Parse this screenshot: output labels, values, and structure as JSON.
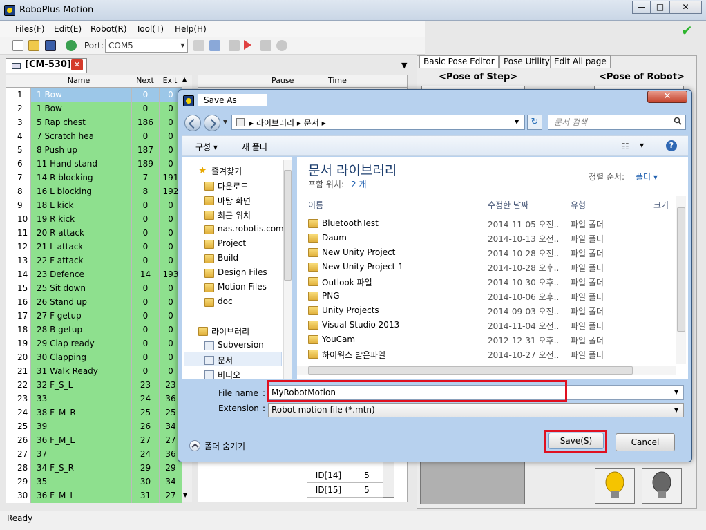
{
  "app": {
    "title": "RoboPlus Motion",
    "min_glyph": "—",
    "max_glyph": "□",
    "close_glyph": "✕"
  },
  "menu": [
    "Files(F)",
    "Edit(E)",
    "Robot(R)",
    "Tool(T)",
    "Help(H)"
  ],
  "toolbar": {
    "port_label": "Port:",
    "port_value": "COM5"
  },
  "cm_tab": {
    "label": "[CM-530]"
  },
  "grid": {
    "headers": [
      "Name",
      "Next",
      "Exit"
    ],
    "rows": [
      {
        "num": "1",
        "name": "1 Bow",
        "next": "0",
        "exit": "0"
      },
      {
        "num": "2",
        "name": "1 Bow",
        "next": "0",
        "exit": "0"
      },
      {
        "num": "3",
        "name": "5 Rap chest",
        "next": "186",
        "exit": "0"
      },
      {
        "num": "4",
        "name": "7 Scratch hea",
        "next": "0",
        "exit": "0"
      },
      {
        "num": "5",
        "name": "8 Push up",
        "next": "187",
        "exit": "0"
      },
      {
        "num": "6",
        "name": "11 Hand stand",
        "next": "189",
        "exit": "0"
      },
      {
        "num": "7",
        "name": "14 R blocking",
        "next": "7",
        "exit": "191"
      },
      {
        "num": "8",
        "name": "16 L blocking",
        "next": "8",
        "exit": "192"
      },
      {
        "num": "9",
        "name": "18 L kick",
        "next": "0",
        "exit": "0"
      },
      {
        "num": "10",
        "name": "19 R kick",
        "next": "0",
        "exit": "0"
      },
      {
        "num": "11",
        "name": "20 R attack",
        "next": "0",
        "exit": "0"
      },
      {
        "num": "12",
        "name": "21 L attack",
        "next": "0",
        "exit": "0"
      },
      {
        "num": "13",
        "name": "22 F attack",
        "next": "0",
        "exit": "0"
      },
      {
        "num": "14",
        "name": "23 Defence",
        "next": "14",
        "exit": "193"
      },
      {
        "num": "15",
        "name": "25 Sit down",
        "next": "0",
        "exit": "0"
      },
      {
        "num": "16",
        "name": "26 Stand up",
        "next": "0",
        "exit": "0"
      },
      {
        "num": "17",
        "name": "27 F getup",
        "next": "0",
        "exit": "0"
      },
      {
        "num": "18",
        "name": "28 B getup",
        "next": "0",
        "exit": "0"
      },
      {
        "num": "19",
        "name": "29 Clap ready",
        "next": "0",
        "exit": "0"
      },
      {
        "num": "20",
        "name": "30 Clapping",
        "next": "0",
        "exit": "0"
      },
      {
        "num": "21",
        "name": "31 Walk Ready",
        "next": "0",
        "exit": "0"
      },
      {
        "num": "22",
        "name": "32 F_S_L",
        "next": "23",
        "exit": "23"
      },
      {
        "num": "23",
        "name": "33",
        "next": "24",
        "exit": "36"
      },
      {
        "num": "24",
        "name": "38 F_M_R",
        "next": "25",
        "exit": "25"
      },
      {
        "num": "25",
        "name": "39",
        "next": "26",
        "exit": "34"
      },
      {
        "num": "26",
        "name": "36 F_M_L",
        "next": "27",
        "exit": "27"
      },
      {
        "num": "27",
        "name": "37",
        "next": "24",
        "exit": "36"
      },
      {
        "num": "28",
        "name": "34 F_S_R",
        "next": "29",
        "exit": "29"
      },
      {
        "num": "29",
        "name": "35",
        "next": "30",
        "exit": "34"
      },
      {
        "num": "30",
        "name": "36 F_M_L",
        "next": "31",
        "exit": "27"
      }
    ]
  },
  "middle": {
    "pause_header": "Pause",
    "time_header": "Time",
    "id_rows": [
      {
        "id": "ID[14]",
        "val": "5"
      },
      {
        "id": "ID[15]",
        "val": "5"
      }
    ]
  },
  "right_panel": {
    "tabs": [
      "Basic Pose Editor",
      "Pose Utility",
      "Edit All page"
    ],
    "pose_step": "<Pose of Step>",
    "pose_robot": "<Pose of Robot>"
  },
  "status": {
    "text": "Ready"
  },
  "dialog": {
    "title": "Save As",
    "address_path": "▸ 라이브러리 ▸ 문서 ▸",
    "search_placeholder": "문서 검색",
    "cmd_organize": "구성 ▾",
    "cmd_new_folder": "새 폴더",
    "nav": {
      "favorites": "즐겨찾기",
      "fav_items": [
        "다운로드",
        "바탕 화면",
        "최근 위치",
        "nas.robotis.com",
        "Project",
        "Build",
        "Design Files",
        "Motion Files",
        "doc"
      ],
      "libraries": "라이브러리",
      "lib_items": [
        "Subversion",
        "문서",
        "비디오"
      ]
    },
    "library_title": "문서 라이브러리",
    "library_sub": "포함 위치:",
    "library_count": "2 개",
    "sort_label": "정렬 순서:",
    "sort_value": "폴더 ▾",
    "columns": [
      "이름",
      "수정한 날짜",
      "유형",
      "크기"
    ],
    "files": [
      {
        "name": "BluetoothTest",
        "date": "2014-11-05 오전...",
        "type": "파일 폴더"
      },
      {
        "name": "Daum",
        "date": "2014-10-13 오전...",
        "type": "파일 폴더"
      },
      {
        "name": "New Unity Project",
        "date": "2014-10-28 오전...",
        "type": "파일 폴더"
      },
      {
        "name": "New Unity Project 1",
        "date": "2014-10-28 오후...",
        "type": "파일 폴더"
      },
      {
        "name": "Outlook 파일",
        "date": "2014-10-30 오후...",
        "type": "파일 폴더"
      },
      {
        "name": "PNG",
        "date": "2014-10-06 오후...",
        "type": "파일 폴더"
      },
      {
        "name": "Unity Projects",
        "date": "2014-09-03 오전...",
        "type": "파일 폴더"
      },
      {
        "name": "Visual Studio 2013",
        "date": "2014-11-04 오전...",
        "type": "파일 폴더"
      },
      {
        "name": "YouCam",
        "date": "2012-12-31 오후...",
        "type": "파일 폴더"
      },
      {
        "name": "하이웍스 받은파일",
        "date": "2014-10-27 오전...",
        "type": "파일 폴더"
      }
    ],
    "filename_label": "File name",
    "filename_value": "MyRobotMotion",
    "extension_label": "Extension",
    "extension_value": "Robot motion file (*.mtn)",
    "colon": ":",
    "hide_folders": "폴더 숨기기",
    "save_label": "Save(S)",
    "cancel_label": "Cancel"
  }
}
